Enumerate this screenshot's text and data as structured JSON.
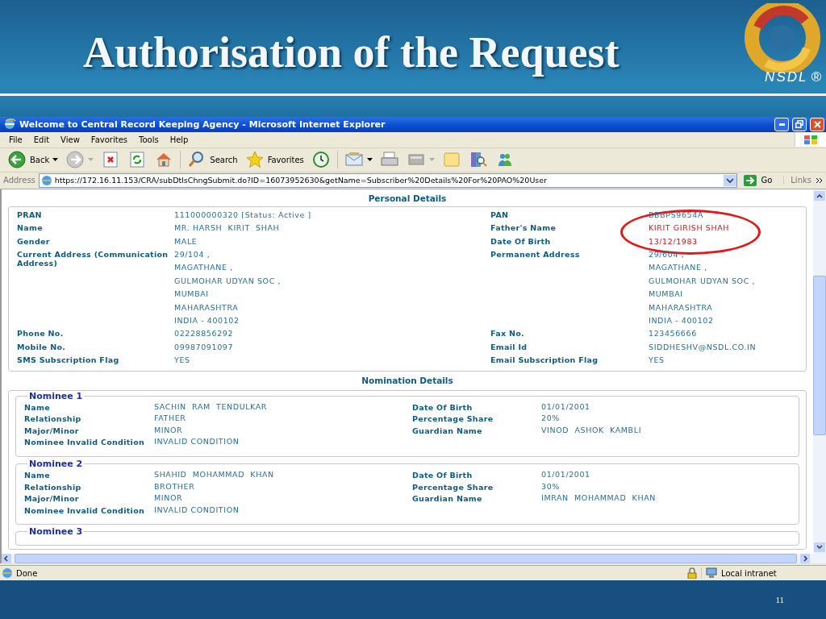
{
  "slide": {
    "title": "Authorisation of the Request",
    "logo_text": "NSDL",
    "logo_mark": "®",
    "page_number": "11"
  },
  "browser": {
    "title": "Welcome to Central Record Keeping Agency - Microsoft Internet Explorer",
    "menu": [
      "File",
      "Edit",
      "View",
      "Favorites",
      "Tools",
      "Help"
    ],
    "toolbar": [
      {
        "kind": "back",
        "label": "Back",
        "dropdown": true
      },
      {
        "kind": "forward",
        "dropdown": true
      },
      {
        "kind": "stop",
        "dropdown": false
      },
      {
        "kind": "refresh",
        "dropdown": false
      },
      {
        "kind": "home",
        "dropdown": false
      },
      {
        "kind": "search",
        "label": "Search",
        "dropdown": false
      },
      {
        "kind": "favorites",
        "label": "Favorites",
        "dropdown": false
      },
      {
        "kind": "history",
        "dropdown": false
      },
      {
        "kind": "mail",
        "dropdown": true
      },
      {
        "kind": "print",
        "dropdown": false
      },
      {
        "kind": "edit",
        "dropdown": true
      },
      {
        "kind": "notes",
        "dropdown": false
      },
      {
        "kind": "research",
        "dropdown": false
      },
      {
        "kind": "messenger",
        "dropdown": false
      }
    ],
    "address": {
      "label": "Address",
      "value": "https://172.16.11.153/CRA/subDtlsChngSubmit.do?ID=16073952630&getName=Subscriber%20Details%20For%20PAO%20User",
      "go": "Go",
      "links": "Links"
    },
    "status_bar": {
      "text": "Done",
      "zone": "Local intranet"
    }
  },
  "personal_details": {
    "title": "Personal Details",
    "rows": [
      {
        "left": {
          "label": "PRAN",
          "lines": [
            "111000000320 [Status: Active ]"
          ]
        },
        "right": {
          "label": "PAN",
          "lines": [
            "BBBPS9654A"
          ],
          "highlighted": false
        }
      },
      {
        "left": {
          "label": "Name",
          "lines": [
            "MR. HARSH  KIRIT  SHAH"
          ]
        },
        "right": {
          "label": "Father's Name",
          "lines": [
            "KIRIT GIRISH SHAH"
          ],
          "highlighted": true
        }
      },
      {
        "left": {
          "label": "Gender",
          "lines": [
            "MALE"
          ]
        },
        "right": {
          "label": "Date Of Birth",
          "lines": [
            "13/12/1983"
          ],
          "highlighted": true
        }
      },
      {
        "left": {
          "label": "Current Address (Communication Address)",
          "lines": [
            "29/104 ,",
            "MAGATHANE ,",
            "GULMOHAR UDYAN SOC ,",
            "MUMBAI",
            "MAHARASHTRA",
            "INDIA - 400102"
          ]
        },
        "right": {
          "label": "Permanent Address",
          "lines": [
            "29/604 ,",
            "MAGATHANE ,",
            "GULMOHAR UDYAN SOC ,",
            "MUMBAI",
            "MAHARASHTRA",
            "INDIA - 400102"
          ],
          "highlighted": false
        }
      },
      {
        "left": {
          "label": "Phone No.",
          "lines": [
            "02228856292"
          ]
        },
        "right": {
          "label": "Fax No.",
          "lines": [
            "123456666"
          ],
          "highlighted": false
        }
      },
      {
        "left": {
          "label": "Mobile No.",
          "lines": [
            "09987091097"
          ]
        },
        "right": {
          "label": "Email Id",
          "lines": [
            "SIDDHESHV@NSDL.CO.IN"
          ],
          "highlighted": false
        }
      },
      {
        "left": {
          "label": "SMS Subscription Flag",
          "lines": [
            "YES"
          ]
        },
        "right": {
          "label": "Email Subscription Flag",
          "lines": [
            "YES"
          ],
          "highlighted": false
        }
      }
    ]
  },
  "nomination_details": {
    "title": "Nomination Details",
    "nominees": [
      {
        "title": "Nominee 1",
        "rows": [
          {
            "label": "Name",
            "value": "SACHIN  RAM  TENDULKAR",
            "label_2": "Date Of Birth",
            "value_2": "01/01/2001"
          },
          {
            "label": "Relationship",
            "value": "FATHER",
            "label_2": "Percentage Share",
            "value_2": "20%"
          },
          {
            "label": "Major/Minor",
            "value": "MINOR",
            "label_2": "Guardian Name",
            "value_2": "VINOD  ASHOK  KAMBLI"
          },
          {
            "label": "Nominee Invalid Condition",
            "value": "INVALID CONDITION"
          }
        ]
      },
      {
        "title": "Nominee 2",
        "rows": [
          {
            "label": "Name",
            "value": "SHAHID  MOHAMMAD  KHAN",
            "label_2": "Date Of Birth",
            "value_2": "01/01/2001"
          },
          {
            "label": "Relationship",
            "value": "BROTHER",
            "label_2": "Percentage Share",
            "value_2": "30%"
          },
          {
            "label": "Major/Minor",
            "value": "MINOR",
            "label_2": "Guardian Name",
            "value_2": "IMRAN  MOHAMMAD  KHAN"
          },
          {
            "label": "Nominee Invalid Condition",
            "value": "INVALID CONDITION"
          }
        ]
      },
      {
        "title": "Nominee 3"
      }
    ]
  }
}
